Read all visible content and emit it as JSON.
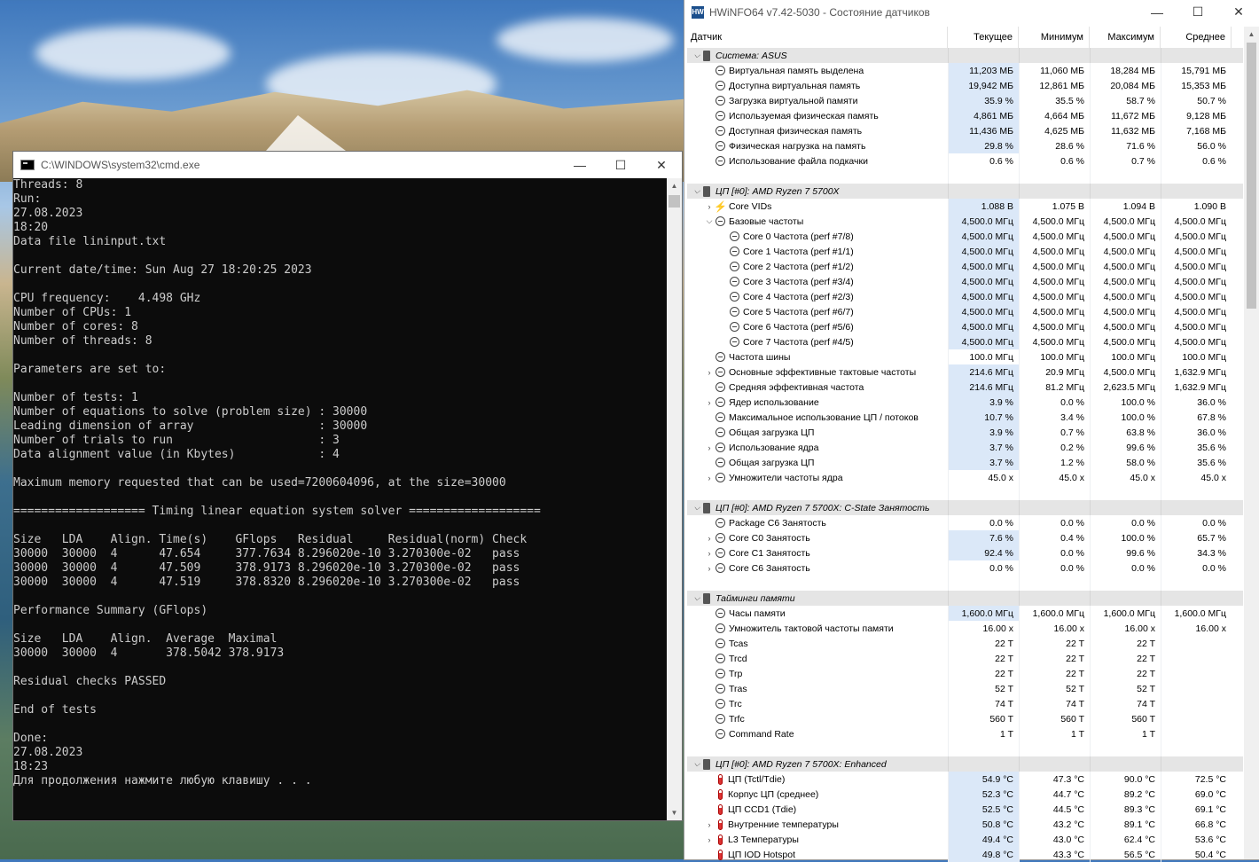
{
  "cmd": {
    "title": "C:\\WINDOWS\\system32\\cmd.exe",
    "lines": [
      "Threads: 8",
      "Run:",
      "27.08.2023",
      "18:20",
      "Data file lininput.txt",
      "",
      "Current date/time: Sun Aug 27 18:20:25 2023",
      "",
      "CPU frequency:    4.498 GHz",
      "Number of CPUs: 1",
      "Number of cores: 8",
      "Number of threads: 8",
      "",
      "Parameters are set to:",
      "",
      "Number of tests: 1",
      "Number of equations to solve (problem size) : 30000",
      "Leading dimension of array                  : 30000",
      "Number of trials to run                     : 3",
      "Data alignment value (in Kbytes)            : 4",
      "",
      "Maximum memory requested that can be used=7200604096, at the size=30000",
      "",
      "=================== Timing linear equation system solver ===================",
      "",
      "Size   LDA    Align. Time(s)    GFlops   Residual     Residual(norm) Check",
      "30000  30000  4      47.654     377.7634 8.296020e-10 3.270300e-02   pass",
      "30000  30000  4      47.509     378.9173 8.296020e-10 3.270300e-02   pass",
      "30000  30000  4      47.519     378.8320 8.296020e-10 3.270300e-02   pass",
      "",
      "Performance Summary (GFlops)",
      "",
      "Size   LDA    Align.  Average  Maximal",
      "30000  30000  4       378.5042 378.9173",
      "",
      "Residual checks PASSED",
      "",
      "End of tests",
      "",
      "Done:",
      "27.08.2023",
      "18:23",
      "Для продолжения нажмите любую клавишу . . ."
    ]
  },
  "hwinfo": {
    "title": "HWiNFO64 v7.42-5030 - Состояние датчиков",
    "columns": [
      "Датчик",
      "Текущее",
      "Минимум",
      "Максимум",
      "Среднее"
    ],
    "rows": [
      {
        "type": "group",
        "name": "Система: ASUS",
        "exp": "v",
        "icon": "chip",
        "vals": [
          "",
          "",
          "",
          ""
        ]
      },
      {
        "type": "sensor",
        "name": "Виртуальная память выделена",
        "icon": "clock",
        "indent": 1,
        "vals": [
          "11,203 МБ",
          "11,060 МБ",
          "18,284 МБ",
          "15,791 МБ"
        ]
      },
      {
        "type": "sensor",
        "name": "Доступна виртуальная память",
        "icon": "clock",
        "indent": 1,
        "vals": [
          "19,942 МБ",
          "12,861 МБ",
          "20,084 МБ",
          "15,353 МБ"
        ]
      },
      {
        "type": "sensor",
        "name": "Загрузка виртуальной памяти",
        "icon": "clock",
        "indent": 1,
        "vals": [
          "35.9 %",
          "35.5 %",
          "58.7 %",
          "50.7 %"
        ]
      },
      {
        "type": "sensor",
        "name": "Используемая физическая память",
        "icon": "clock",
        "indent": 1,
        "vals": [
          "4,861 МБ",
          "4,664 МБ",
          "11,672 МБ",
          "9,128 МБ"
        ]
      },
      {
        "type": "sensor",
        "name": "Доступная физическая память",
        "icon": "clock",
        "indent": 1,
        "vals": [
          "11,436 МБ",
          "4,625 МБ",
          "11,632 МБ",
          "7,168 МБ"
        ]
      },
      {
        "type": "sensor",
        "name": "Физическая нагрузка на память",
        "icon": "clock",
        "indent": 1,
        "vals": [
          "29.8 %",
          "28.6 %",
          "71.6 %",
          "56.0 %"
        ]
      },
      {
        "type": "sensor",
        "name": "Использование файла подкачки",
        "icon": "clock",
        "indent": 1,
        "plain": true,
        "vals": [
          "0.6 %",
          "0.6 %",
          "0.7 %",
          "0.6 %"
        ]
      },
      {
        "type": "blank",
        "vals": [
          "",
          "",
          "",
          ""
        ]
      },
      {
        "type": "group",
        "name": "ЦП [#0]: AMD Ryzen 7 5700X",
        "exp": "v",
        "icon": "chip",
        "vals": [
          "",
          "",
          "",
          ""
        ]
      },
      {
        "type": "sensor",
        "name": "Core VIDs",
        "exp": ">",
        "icon": "volt",
        "indent": 1,
        "vals": [
          "1.088 В",
          "1.075 В",
          "1.094 В",
          "1.090 В"
        ]
      },
      {
        "type": "sensor",
        "name": "Базовые частоты",
        "exp": "v",
        "icon": "clock",
        "indent": 1,
        "vals": [
          "4,500.0 МГц",
          "4,500.0 МГц",
          "4,500.0 МГц",
          "4,500.0 МГц"
        ]
      },
      {
        "type": "sensor",
        "name": "Core 0 Частота (perf #7/8)",
        "icon": "clock",
        "indent": 2,
        "vals": [
          "4,500.0 МГц",
          "4,500.0 МГц",
          "4,500.0 МГц",
          "4,500.0 МГц"
        ]
      },
      {
        "type": "sensor",
        "name": "Core 1 Частота (perf #1/1)",
        "icon": "clock",
        "indent": 2,
        "vals": [
          "4,500.0 МГц",
          "4,500.0 МГц",
          "4,500.0 МГц",
          "4,500.0 МГц"
        ]
      },
      {
        "type": "sensor",
        "name": "Core 2 Частота (perf #1/2)",
        "icon": "clock",
        "indent": 2,
        "vals": [
          "4,500.0 МГц",
          "4,500.0 МГц",
          "4,500.0 МГц",
          "4,500.0 МГц"
        ]
      },
      {
        "type": "sensor",
        "name": "Core 3 Частота (perf #3/4)",
        "icon": "clock",
        "indent": 2,
        "vals": [
          "4,500.0 МГц",
          "4,500.0 МГц",
          "4,500.0 МГц",
          "4,500.0 МГц"
        ]
      },
      {
        "type": "sensor",
        "name": "Core 4 Частота (perf #2/3)",
        "icon": "clock",
        "indent": 2,
        "vals": [
          "4,500.0 МГц",
          "4,500.0 МГц",
          "4,500.0 МГц",
          "4,500.0 МГц"
        ]
      },
      {
        "type": "sensor",
        "name": "Core 5 Частота (perf #6/7)",
        "icon": "clock",
        "indent": 2,
        "vals": [
          "4,500.0 МГц",
          "4,500.0 МГц",
          "4,500.0 МГц",
          "4,500.0 МГц"
        ]
      },
      {
        "type": "sensor",
        "name": "Core 6 Частота (perf #5/6)",
        "icon": "clock",
        "indent": 2,
        "vals": [
          "4,500.0 МГц",
          "4,500.0 МГц",
          "4,500.0 МГц",
          "4,500.0 МГц"
        ]
      },
      {
        "type": "sensor",
        "name": "Core 7 Частота (perf #4/5)",
        "icon": "clock",
        "indent": 2,
        "vals": [
          "4,500.0 МГц",
          "4,500.0 МГц",
          "4,500.0 МГц",
          "4,500.0 МГц"
        ]
      },
      {
        "type": "sensor",
        "name": "Частота шины",
        "icon": "clock",
        "indent": 1,
        "plain": true,
        "vals": [
          "100.0 МГц",
          "100.0 МГц",
          "100.0 МГц",
          "100.0 МГц"
        ]
      },
      {
        "type": "sensor",
        "name": "Основные эффективные тактовые частоты",
        "exp": ">",
        "icon": "clock",
        "indent": 1,
        "vals": [
          "214.6 МГц",
          "20.9 МГц",
          "4,500.0 МГц",
          "1,632.9 МГц"
        ]
      },
      {
        "type": "sensor",
        "name": "Средняя эффективная частота",
        "icon": "clock",
        "indent": 1,
        "vals": [
          "214.6 МГц",
          "81.2 МГц",
          "2,623.5 МГц",
          "1,632.9 МГц"
        ]
      },
      {
        "type": "sensor",
        "name": "Ядер использование",
        "exp": ">",
        "icon": "clock",
        "indent": 1,
        "vals": [
          "3.9 %",
          "0.0 %",
          "100.0 %",
          "36.0 %"
        ]
      },
      {
        "type": "sensor",
        "name": "Максимальное использование ЦП / потоков",
        "icon": "clock",
        "indent": 1,
        "vals": [
          "10.7 %",
          "3.4 %",
          "100.0 %",
          "67.8 %"
        ]
      },
      {
        "type": "sensor",
        "name": "Общая загрузка ЦП",
        "icon": "clock",
        "indent": 1,
        "vals": [
          "3.9 %",
          "0.7 %",
          "63.8 %",
          "36.0 %"
        ]
      },
      {
        "type": "sensor",
        "name": "Использование ядра",
        "exp": ">",
        "icon": "clock",
        "indent": 1,
        "vals": [
          "3.7 %",
          "0.2 %",
          "99.6 %",
          "35.6 %"
        ]
      },
      {
        "type": "sensor",
        "name": "Общая загрузка ЦП",
        "icon": "clock",
        "indent": 1,
        "vals": [
          "3.7 %",
          "1.2 %",
          "58.0 %",
          "35.6 %"
        ]
      },
      {
        "type": "sensor",
        "name": "Умножители частоты ядра",
        "exp": ">",
        "icon": "clock",
        "indent": 1,
        "plain": true,
        "vals": [
          "45.0 x",
          "45.0 x",
          "45.0 x",
          "45.0 x"
        ]
      },
      {
        "type": "blank",
        "vals": [
          "",
          "",
          "",
          ""
        ]
      },
      {
        "type": "group",
        "name": "ЦП [#0]: AMD Ryzen 7 5700X: C-State Занятость",
        "exp": "v",
        "icon": "chip",
        "vals": [
          "",
          "",
          "",
          ""
        ]
      },
      {
        "type": "sensor",
        "name": "Package C6 Занятость",
        "icon": "clock",
        "indent": 1,
        "plain": true,
        "vals": [
          "0.0 %",
          "0.0 %",
          "0.0 %",
          "0.0 %"
        ]
      },
      {
        "type": "sensor",
        "name": "Core C0 Занятость",
        "exp": ">",
        "icon": "clock",
        "indent": 1,
        "vals": [
          "7.6 %",
          "0.4 %",
          "100.0 %",
          "65.7 %"
        ]
      },
      {
        "type": "sensor",
        "name": "Core C1 Занятость",
        "exp": ">",
        "icon": "clock",
        "indent": 1,
        "vals": [
          "92.4 %",
          "0.0 %",
          "99.6 %",
          "34.3 %"
        ]
      },
      {
        "type": "sensor",
        "name": "Core C6 Занятость",
        "exp": ">",
        "icon": "clock",
        "indent": 1,
        "plain": true,
        "vals": [
          "0.0 %",
          "0.0 %",
          "0.0 %",
          "0.0 %"
        ]
      },
      {
        "type": "blank",
        "vals": [
          "",
          "",
          "",
          ""
        ]
      },
      {
        "type": "group",
        "name": "Тайминги памяти",
        "exp": "v",
        "icon": "chip",
        "vals": [
          "",
          "",
          "",
          ""
        ]
      },
      {
        "type": "sensor",
        "name": "Часы памяти",
        "icon": "clock",
        "indent": 1,
        "vals": [
          "1,600.0 МГц",
          "1,600.0 МГц",
          "1,600.0 МГц",
          "1,600.0 МГц"
        ]
      },
      {
        "type": "sensor",
        "name": "Умножитель тактовой частоты памяти",
        "icon": "clock",
        "indent": 1,
        "plain": true,
        "vals": [
          "16.00 x",
          "16.00 x",
          "16.00 x",
          "16.00 x"
        ]
      },
      {
        "type": "sensor",
        "name": "Tcas",
        "icon": "clock",
        "indent": 1,
        "plain": true,
        "vals": [
          "22 T",
          "22 T",
          "22 T",
          ""
        ]
      },
      {
        "type": "sensor",
        "name": "Trcd",
        "icon": "clock",
        "indent": 1,
        "plain": true,
        "vals": [
          "22 T",
          "22 T",
          "22 T",
          ""
        ]
      },
      {
        "type": "sensor",
        "name": "Trp",
        "icon": "clock",
        "indent": 1,
        "plain": true,
        "vals": [
          "22 T",
          "22 T",
          "22 T",
          ""
        ]
      },
      {
        "type": "sensor",
        "name": "Tras",
        "icon": "clock",
        "indent": 1,
        "plain": true,
        "vals": [
          "52 T",
          "52 T",
          "52 T",
          ""
        ]
      },
      {
        "type": "sensor",
        "name": "Trc",
        "icon": "clock",
        "indent": 1,
        "plain": true,
        "vals": [
          "74 T",
          "74 T",
          "74 T",
          ""
        ]
      },
      {
        "type": "sensor",
        "name": "Trfc",
        "icon": "clock",
        "indent": 1,
        "plain": true,
        "vals": [
          "560 T",
          "560 T",
          "560 T",
          ""
        ]
      },
      {
        "type": "sensor",
        "name": "Command Rate",
        "icon": "clock",
        "indent": 1,
        "plain": true,
        "vals": [
          "1 T",
          "1 T",
          "1 T",
          ""
        ]
      },
      {
        "type": "blank",
        "vals": [
          "",
          "",
          "",
          ""
        ]
      },
      {
        "type": "group",
        "name": "ЦП [#0]: AMD Ryzen 7 5700X: Enhanced",
        "exp": "v",
        "icon": "chip",
        "vals": [
          "",
          "",
          "",
          ""
        ]
      },
      {
        "type": "sensor",
        "name": "ЦП (Tctl/Tdie)",
        "icon": "therm",
        "indent": 1,
        "vals": [
          "54.9 °C",
          "47.3 °C",
          "90.0 °C",
          "72.5 °C"
        ]
      },
      {
        "type": "sensor",
        "name": "Корпус ЦП (среднее)",
        "icon": "therm",
        "indent": 1,
        "vals": [
          "52.3 °C",
          "44.7 °C",
          "89.2 °C",
          "69.0 °C"
        ]
      },
      {
        "type": "sensor",
        "name": "ЦП CCD1 (Tdie)",
        "icon": "therm",
        "indent": 1,
        "vals": [
          "52.5 °C",
          "44.5 °C",
          "89.3 °C",
          "69.1 °C"
        ]
      },
      {
        "type": "sensor",
        "name": "Внутренние температуры",
        "exp": ">",
        "icon": "therm",
        "indent": 1,
        "vals": [
          "50.8 °C",
          "43.2 °C",
          "89.1 °C",
          "66.8 °C"
        ]
      },
      {
        "type": "sensor",
        "name": "L3 Температуры",
        "exp": ">",
        "icon": "therm",
        "indent": 1,
        "vals": [
          "49.4 °C",
          "43.0 °C",
          "62.4 °C",
          "53.6 °C"
        ]
      },
      {
        "type": "sensor",
        "name": "ЦП IOD Hotspot",
        "icon": "therm",
        "indent": 1,
        "vals": [
          "49.8 °C",
          "43.3 °C",
          "56.5 °C",
          "50.4 °C"
        ]
      }
    ]
  },
  "window_controls": {
    "minimize": "—",
    "maximize": "☐",
    "close": "✕"
  }
}
